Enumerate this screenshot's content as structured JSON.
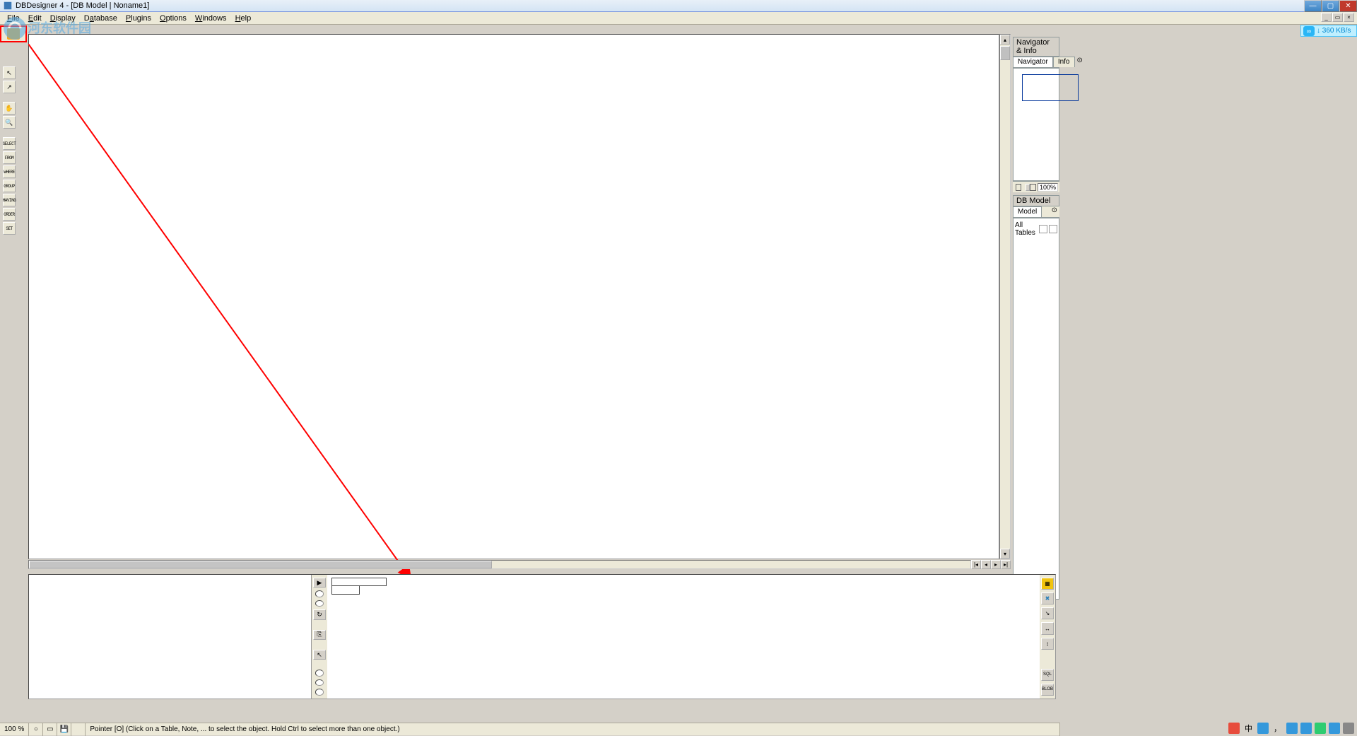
{
  "window": {
    "title": "DBDesigner 4 - [DB Model | Noname1]"
  },
  "menubar": {
    "items": [
      {
        "label": "File",
        "key": "F"
      },
      {
        "label": "Edit",
        "key": "E"
      },
      {
        "label": "Display",
        "key": "D"
      },
      {
        "label": "Database",
        "key": "a"
      },
      {
        "label": "Plugins",
        "key": "P"
      },
      {
        "label": "Options",
        "key": "O"
      },
      {
        "label": "Windows",
        "key": "W"
      },
      {
        "label": "Help",
        "key": "H"
      }
    ]
  },
  "netspeed": {
    "down": "↓ 360 KB/s"
  },
  "watermark": {
    "url": "www.pc0359.cn"
  },
  "left_sql_buttons": {
    "select": "SELECT",
    "from": "FROM",
    "where": "WHERE",
    "group": "GROUP",
    "having": "HAVING",
    "order": "ORDER",
    "set": "SET"
  },
  "right_panels": {
    "nav_header": "Navigator & Info",
    "tab_nav": "Navigator",
    "tab_info": "Info",
    "zoom": "100%",
    "model_header": "DB Model",
    "tab_model": "Model",
    "all_tables": "All Tables"
  },
  "bottom_right_tools": {
    "sql": "SQL",
    "blob": "BLOB"
  },
  "statusbar": {
    "zoom": "100 %",
    "hint": "Pointer [O] (Click on a Table, Note, ... to select the object. Hold Ctrl to select more than one object.)"
  },
  "tray": {
    "ime": "中"
  }
}
